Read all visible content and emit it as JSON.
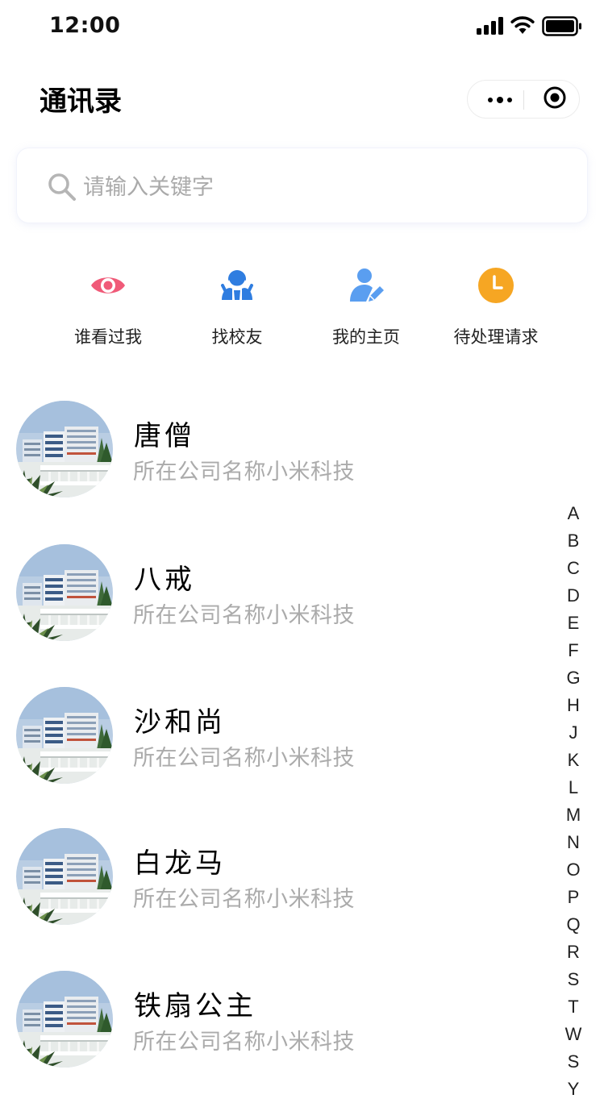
{
  "status_bar": {
    "time": "12:00"
  },
  "nav": {
    "title": "通讯录"
  },
  "search": {
    "placeholder": "请输入关键字",
    "value": ""
  },
  "quick_actions": [
    {
      "label": "谁看过我",
      "icon": "eye-icon",
      "color": "#f05a78"
    },
    {
      "label": "找校友",
      "icon": "alumni-icon",
      "color": "#2f7de0"
    },
    {
      "label": "我的主页",
      "icon": "user-edit-icon",
      "color": "#5a9ef0"
    },
    {
      "label": "待处理请求",
      "icon": "clock-icon",
      "color": "#f6a623"
    }
  ],
  "contacts": [
    {
      "name": "唐僧",
      "company": "所在公司名称小米科技"
    },
    {
      "name": "八戒",
      "company": "所在公司名称小米科技"
    },
    {
      "name": "沙和尚",
      "company": "所在公司名称小米科技"
    },
    {
      "name": "白龙马",
      "company": "所在公司名称小米科技"
    },
    {
      "name": "铁扇公主",
      "company": "所在公司名称小米科技"
    }
  ],
  "index_letters": [
    "A",
    "B",
    "C",
    "D",
    "E",
    "F",
    "G",
    "H",
    "J",
    "K",
    "L",
    "M",
    "N",
    "O",
    "P",
    "Q",
    "R",
    "S",
    "T",
    "W",
    "S",
    "Y"
  ]
}
